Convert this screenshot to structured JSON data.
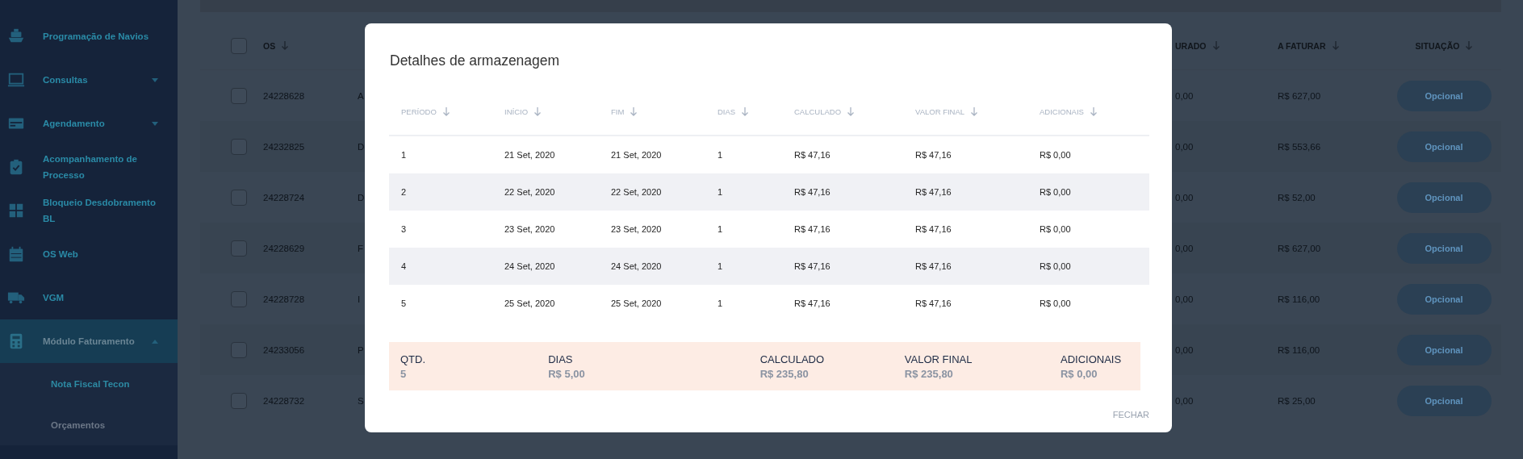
{
  "sidebar": {
    "items": [
      {
        "label": "Programação de Navios",
        "selected": false
      },
      {
        "label": "Consultas",
        "selected": false,
        "expanded": false
      },
      {
        "label": "Agendamento",
        "selected": false,
        "expanded": false
      },
      {
        "label": "Acompanhamento de Processo",
        "selected": false
      },
      {
        "label": "Bloqueio Desdobramento BL",
        "selected": false
      },
      {
        "label": "OS Web",
        "selected": false
      },
      {
        "label": "VGM",
        "selected": false
      },
      {
        "label": "Módulo Faturamento",
        "selected": true,
        "expanded": true,
        "children": [
          {
            "label": "Nota Fiscal Tecon",
            "selected": true
          },
          {
            "label": "Orçamentos",
            "selected": false
          }
        ]
      }
    ]
  },
  "table": {
    "columns": [
      "OS",
      "URADO",
      "A FATURAR",
      "SITUAÇÃO"
    ],
    "select_all_checked": false,
    "rows": [
      {
        "os": "24228628",
        "column_2": "A",
        "column_3": "0,00",
        "a_faturar": "R$ 627,00",
        "situacao": "Opcional",
        "checked": false
      },
      {
        "os": "24232825",
        "column_2": "D",
        "column_3": "0,00",
        "a_faturar": "R$ 553,66",
        "situacao": "Opcional",
        "checked": false
      },
      {
        "os": "24228724",
        "column_2": "D",
        "column_3": "0,00",
        "a_faturar": "R$ 52,00",
        "situacao": "Opcional",
        "checked": false
      },
      {
        "os": "24228629",
        "column_2": "F",
        "column_3": "0,00",
        "a_faturar": "R$ 627,00",
        "situacao": "Opcional",
        "checked": false
      },
      {
        "os": "24228728",
        "column_2": "I",
        "column_3": "0,00",
        "a_faturar": "R$ 116,00",
        "situacao": "Opcional",
        "checked": false
      },
      {
        "os": "24233056",
        "column_2": "P",
        "column_3": "0,00",
        "a_faturar": "R$ 116,00",
        "situacao": "Opcional",
        "checked": false
      },
      {
        "os": "24228732",
        "column_2": "S",
        "column_3": "0,00",
        "a_faturar": "R$ 25,00",
        "situacao": "Opcional",
        "checked": false
      }
    ]
  },
  "modal": {
    "title": "Detalhes de armazenagem",
    "columns": [
      "PERÍODO",
      "INÍCIO",
      "FIM",
      "DIAS",
      "CALCULADO",
      "VALOR FINAL",
      "ADICIONAIS"
    ],
    "rows": [
      [
        "1",
        "21 Set, 2020",
        "21 Set, 2020",
        "1",
        "R$ 47,16",
        "R$ 47,16",
        "R$ 0,00"
      ],
      [
        "2",
        "22 Set, 2020",
        "22 Set, 2020",
        "1",
        "R$ 47,16",
        "R$ 47,16",
        "R$ 0,00"
      ],
      [
        "3",
        "23 Set, 2020",
        "23 Set, 2020",
        "1",
        "R$ 47,16",
        "R$ 47,16",
        "R$ 0,00"
      ],
      [
        "4",
        "24 Set, 2020",
        "24 Set, 2020",
        "1",
        "R$ 47,16",
        "R$ 47,16",
        "R$ 0,00"
      ],
      [
        "5",
        "25 Set, 2020",
        "25 Set, 2020",
        "1",
        "R$ 47,16",
        "R$ 47,16",
        "R$ 0,00"
      ]
    ],
    "summary": [
      {
        "label": "QTD.",
        "value": "5"
      },
      {
        "label": "DIAS",
        "value": "R$ 5,00"
      },
      {
        "label": "CALCULADO",
        "value": "R$ 235,80"
      },
      {
        "label": "VALOR FINAL",
        "value": "R$ 235,80"
      },
      {
        "label": "ADICIONAIS",
        "value": "R$ 0,00"
      }
    ],
    "close_button": "FECHAR"
  }
}
